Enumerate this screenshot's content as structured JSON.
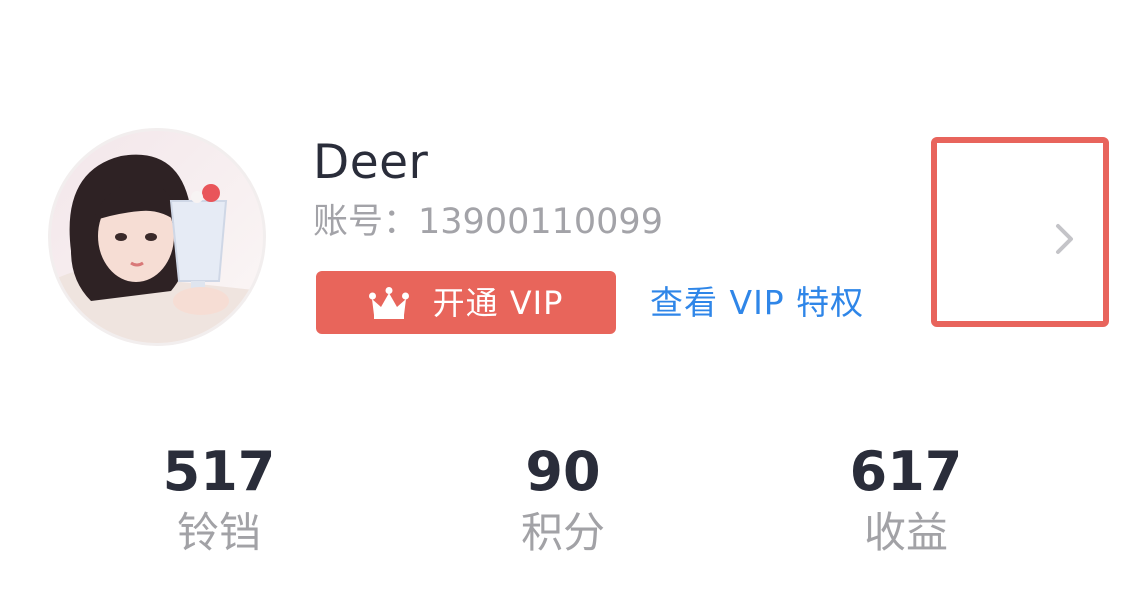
{
  "user": {
    "name": "Deer",
    "account_label": "账号：",
    "account_number": "13900110099"
  },
  "vip": {
    "open_label": "开通 VIP",
    "privilege_link": "查看 VIP 特权"
  },
  "icons": {
    "crown": "crown-icon",
    "chevron": "chevron-right-icon"
  },
  "colors": {
    "vip_button": "#e8655b",
    "link": "#2f86e8",
    "highlight_border": "#e8645c",
    "text_primary": "#2a2d3a",
    "text_secondary": "#a3a3a8"
  },
  "stats": [
    {
      "value": "517",
      "label": "铃铛"
    },
    {
      "value": "90",
      "label": "积分"
    },
    {
      "value": "617",
      "label": "收益"
    }
  ]
}
